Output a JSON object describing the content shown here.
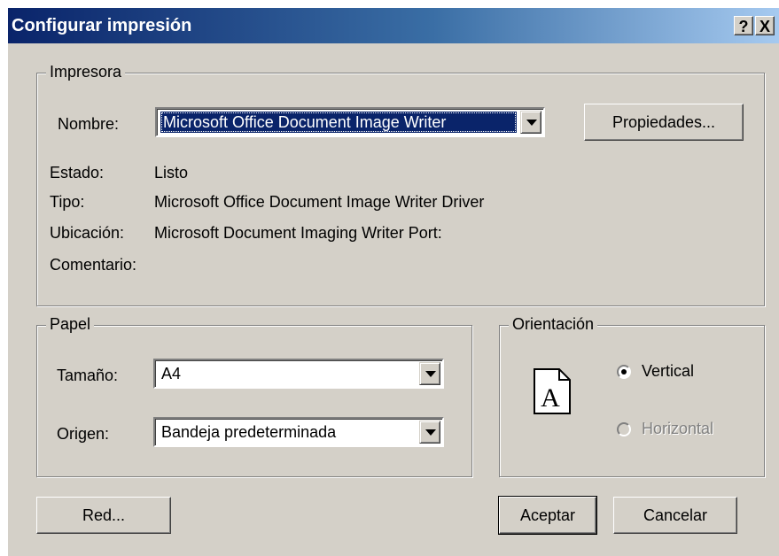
{
  "window": {
    "title": "Configurar impresión",
    "help_button": "?",
    "close_button": "X"
  },
  "printer": {
    "group_label": "Impresora",
    "name_label": "Nombre:",
    "name_value": "Microsoft Office Document Image Writer",
    "properties_button": "Propiedades...",
    "status_label": "Estado:",
    "status_value": "Listo",
    "type_label": "Tipo:",
    "type_value": "Microsoft Office Document Image Writer Driver",
    "location_label": "Ubicación:",
    "location_value": "Microsoft Document Imaging Writer Port:",
    "comment_label": "Comentario:",
    "comment_value": ""
  },
  "paper": {
    "group_label": "Papel",
    "size_label": "Tamaño:",
    "size_value": "A4",
    "source_label": "Origen:",
    "source_value": "Bandeja predeterminada"
  },
  "orientation": {
    "group_label": "Orientación",
    "page_glyph": "A",
    "vertical_label": "Vertical",
    "horizontal_label": "Horizontal",
    "selected": "Vertical"
  },
  "buttons": {
    "network": "Red...",
    "accept": "Aceptar",
    "cancel": "Cancelar"
  }
}
